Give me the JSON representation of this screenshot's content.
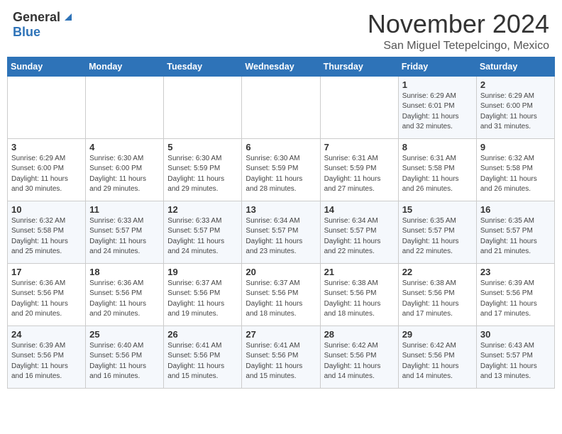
{
  "header": {
    "logo_general": "General",
    "logo_blue": "Blue",
    "month_title": "November 2024",
    "location": "San Miguel Tetepelcingo, Mexico"
  },
  "days_of_week": [
    "Sunday",
    "Monday",
    "Tuesday",
    "Wednesday",
    "Thursday",
    "Friday",
    "Saturday"
  ],
  "weeks": [
    [
      {
        "day": "",
        "info": ""
      },
      {
        "day": "",
        "info": ""
      },
      {
        "day": "",
        "info": ""
      },
      {
        "day": "",
        "info": ""
      },
      {
        "day": "",
        "info": ""
      },
      {
        "day": "1",
        "info": "Sunrise: 6:29 AM\nSunset: 6:01 PM\nDaylight: 11 hours and 32 minutes."
      },
      {
        "day": "2",
        "info": "Sunrise: 6:29 AM\nSunset: 6:00 PM\nDaylight: 11 hours and 31 minutes."
      }
    ],
    [
      {
        "day": "3",
        "info": "Sunrise: 6:29 AM\nSunset: 6:00 PM\nDaylight: 11 hours and 30 minutes."
      },
      {
        "day": "4",
        "info": "Sunrise: 6:30 AM\nSunset: 6:00 PM\nDaylight: 11 hours and 29 minutes."
      },
      {
        "day": "5",
        "info": "Sunrise: 6:30 AM\nSunset: 5:59 PM\nDaylight: 11 hours and 29 minutes."
      },
      {
        "day": "6",
        "info": "Sunrise: 6:30 AM\nSunset: 5:59 PM\nDaylight: 11 hours and 28 minutes."
      },
      {
        "day": "7",
        "info": "Sunrise: 6:31 AM\nSunset: 5:59 PM\nDaylight: 11 hours and 27 minutes."
      },
      {
        "day": "8",
        "info": "Sunrise: 6:31 AM\nSunset: 5:58 PM\nDaylight: 11 hours and 26 minutes."
      },
      {
        "day": "9",
        "info": "Sunrise: 6:32 AM\nSunset: 5:58 PM\nDaylight: 11 hours and 26 minutes."
      }
    ],
    [
      {
        "day": "10",
        "info": "Sunrise: 6:32 AM\nSunset: 5:58 PM\nDaylight: 11 hours and 25 minutes."
      },
      {
        "day": "11",
        "info": "Sunrise: 6:33 AM\nSunset: 5:57 PM\nDaylight: 11 hours and 24 minutes."
      },
      {
        "day": "12",
        "info": "Sunrise: 6:33 AM\nSunset: 5:57 PM\nDaylight: 11 hours and 24 minutes."
      },
      {
        "day": "13",
        "info": "Sunrise: 6:34 AM\nSunset: 5:57 PM\nDaylight: 11 hours and 23 minutes."
      },
      {
        "day": "14",
        "info": "Sunrise: 6:34 AM\nSunset: 5:57 PM\nDaylight: 11 hours and 22 minutes."
      },
      {
        "day": "15",
        "info": "Sunrise: 6:35 AM\nSunset: 5:57 PM\nDaylight: 11 hours and 22 minutes."
      },
      {
        "day": "16",
        "info": "Sunrise: 6:35 AM\nSunset: 5:57 PM\nDaylight: 11 hours and 21 minutes."
      }
    ],
    [
      {
        "day": "17",
        "info": "Sunrise: 6:36 AM\nSunset: 5:56 PM\nDaylight: 11 hours and 20 minutes."
      },
      {
        "day": "18",
        "info": "Sunrise: 6:36 AM\nSunset: 5:56 PM\nDaylight: 11 hours and 20 minutes."
      },
      {
        "day": "19",
        "info": "Sunrise: 6:37 AM\nSunset: 5:56 PM\nDaylight: 11 hours and 19 minutes."
      },
      {
        "day": "20",
        "info": "Sunrise: 6:37 AM\nSunset: 5:56 PM\nDaylight: 11 hours and 18 minutes."
      },
      {
        "day": "21",
        "info": "Sunrise: 6:38 AM\nSunset: 5:56 PM\nDaylight: 11 hours and 18 minutes."
      },
      {
        "day": "22",
        "info": "Sunrise: 6:38 AM\nSunset: 5:56 PM\nDaylight: 11 hours and 17 minutes."
      },
      {
        "day": "23",
        "info": "Sunrise: 6:39 AM\nSunset: 5:56 PM\nDaylight: 11 hours and 17 minutes."
      }
    ],
    [
      {
        "day": "24",
        "info": "Sunrise: 6:39 AM\nSunset: 5:56 PM\nDaylight: 11 hours and 16 minutes."
      },
      {
        "day": "25",
        "info": "Sunrise: 6:40 AM\nSunset: 5:56 PM\nDaylight: 11 hours and 16 minutes."
      },
      {
        "day": "26",
        "info": "Sunrise: 6:41 AM\nSunset: 5:56 PM\nDaylight: 11 hours and 15 minutes."
      },
      {
        "day": "27",
        "info": "Sunrise: 6:41 AM\nSunset: 5:56 PM\nDaylight: 11 hours and 15 minutes."
      },
      {
        "day": "28",
        "info": "Sunrise: 6:42 AM\nSunset: 5:56 PM\nDaylight: 11 hours and 14 minutes."
      },
      {
        "day": "29",
        "info": "Sunrise: 6:42 AM\nSunset: 5:56 PM\nDaylight: 11 hours and 14 minutes."
      },
      {
        "day": "30",
        "info": "Sunrise: 6:43 AM\nSunset: 5:57 PM\nDaylight: 11 hours and 13 minutes."
      }
    ]
  ]
}
